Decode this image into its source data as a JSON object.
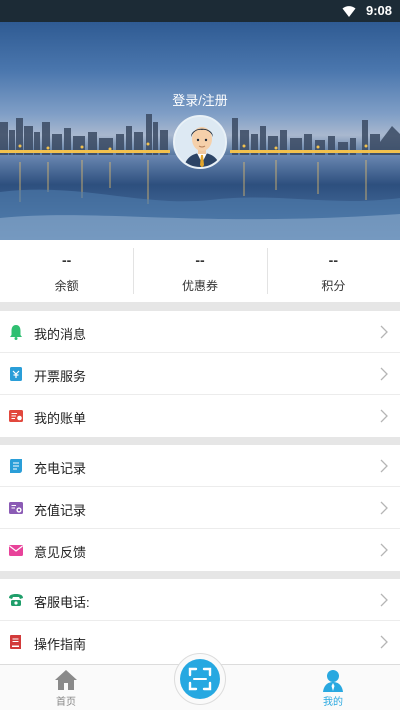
{
  "status_bar": {
    "time": "9:08",
    "wifi_icon": "wifi-icon"
  },
  "profile": {
    "login_text": "登录/注册",
    "avatar_icon": "user-avatar"
  },
  "stats": [
    {
      "value": "--",
      "label": "余额"
    },
    {
      "value": "--",
      "label": "优惠券"
    },
    {
      "value": "--",
      "label": "积分"
    }
  ],
  "menu_groups": [
    [
      {
        "label": "我的消息",
        "icon": "bell-icon",
        "color": "#2fbf71"
      },
      {
        "label": "开票服务",
        "icon": "invoice-icon",
        "color": "#2a9ed8"
      },
      {
        "label": "我的账单",
        "icon": "bill-icon",
        "color": "#e2483d"
      }
    ],
    [
      {
        "label": "充电记录",
        "icon": "charge-record-icon",
        "color": "#2a9ed8"
      },
      {
        "label": "充值记录",
        "icon": "recharge-record-icon",
        "color": "#8b5bb5"
      },
      {
        "label": "意见反馈",
        "icon": "feedback-mail-icon",
        "color": "#e8439a"
      }
    ],
    [
      {
        "label": "客服电话:",
        "icon": "phone-icon",
        "color": "#1f9e6a"
      },
      {
        "label": "操作指南",
        "icon": "guide-book-icon",
        "color": "#d23a3a"
      }
    ]
  ],
  "bottom_nav": {
    "home_label": "首页",
    "mine_label": "我的",
    "scan_icon": "scan-icon",
    "active_color": "#29a8e0"
  }
}
